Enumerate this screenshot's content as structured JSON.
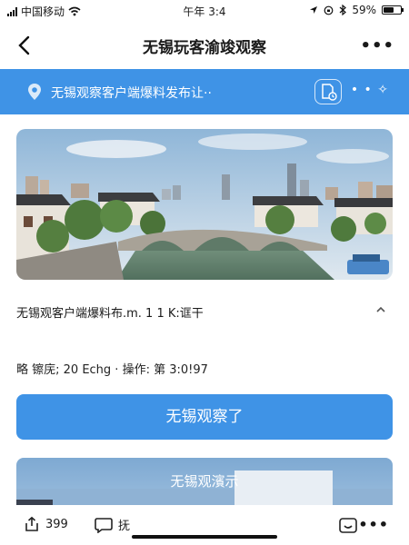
{
  "status_bar": {
    "carrier": "中国移动",
    "time": "午年 3:4",
    "battery": "59%",
    "battery_level": 0.59
  },
  "nav": {
    "title": "无锡玩客渝竣观察",
    "more": "•••"
  },
  "banner": {
    "text": "无锡观察客户端爆料发布让··",
    "dots": "• • ✧"
  },
  "article": {
    "info": "无锡观客户端爆料布.m. 1 1 K:诓干",
    "meta": "略 镲庑; 20 Echg · 操作:  第 3:0!97"
  },
  "primary_button": {
    "label": "无锡观察了"
  },
  "preview": {
    "title": "无锡观濱示"
  },
  "bottom_bar": {
    "share_count": "399",
    "comment_label": "抚",
    "more": "•••"
  },
  "colors": {
    "accent": "#3f93e6"
  }
}
